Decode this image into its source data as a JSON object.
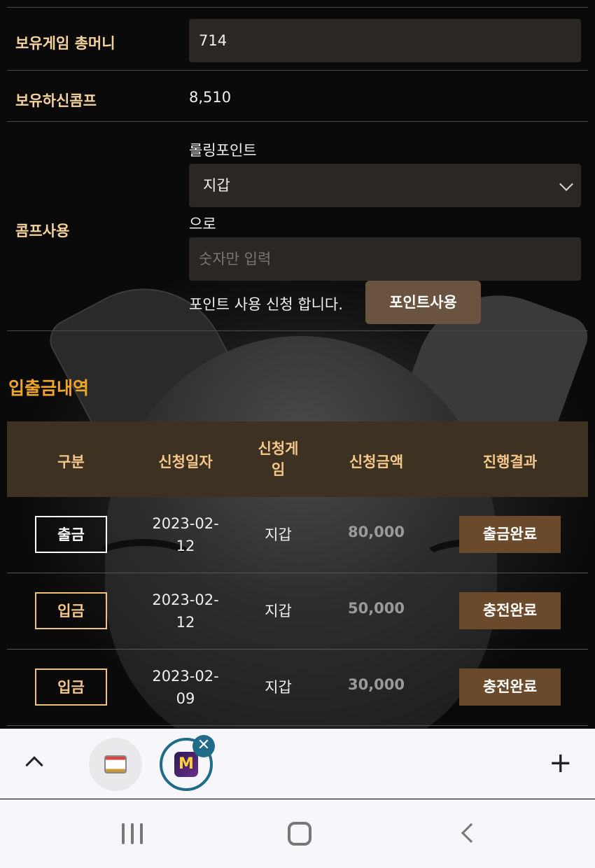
{
  "form": {
    "money_label": "보유게임 총머니",
    "money_value": "714",
    "comp_label": "보유하신콤프",
    "comp_value": "8,510",
    "use_label": "콤프사용",
    "rolling_label": "롤링포인트",
    "wallet_select": "지갑",
    "to_label": "으로",
    "amount_placeholder": "숫자만 입력",
    "apply_text": "포인트 사용 신청 합니다.",
    "apply_button": "포인트사용"
  },
  "history": {
    "title": "입출금내역",
    "columns": [
      "구분",
      "신청일자",
      "신청게임",
      "신청금액",
      "진행결과"
    ],
    "rows": [
      {
        "type": "출금",
        "date": "2023-02-12",
        "game": "지갑",
        "amount": "80,000",
        "result": "출금완료"
      },
      {
        "type": "입금",
        "date": "2023-02-12",
        "game": "지갑",
        "amount": "50,000",
        "result": "충전완료"
      },
      {
        "type": "입금",
        "date": "2023-02-09",
        "game": "지갑",
        "amount": "30,000",
        "result": "충전완료"
      }
    ]
  },
  "tabbar": {
    "tab2_letter": "M",
    "close_glyph": "✕",
    "plus_glyph": "+"
  },
  "colors": {
    "label": "#f5d29a",
    "title": "#f0a526",
    "table_header_bg": "#3d3122",
    "result_bg": "#6a4a2b",
    "button_bg": "#6a543f"
  }
}
